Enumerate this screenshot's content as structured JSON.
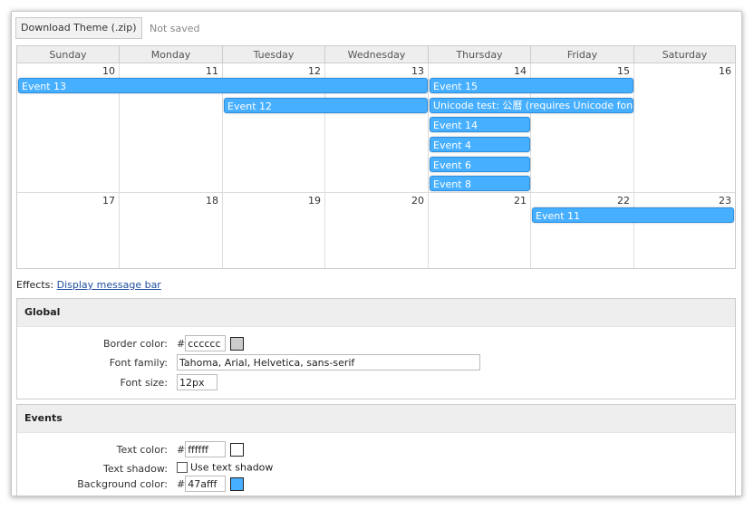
{
  "toolbar": {
    "download_label": "Download Theme (.zip)",
    "status": "Not saved"
  },
  "calendar": {
    "headers": [
      "Sunday",
      "Monday",
      "Tuesday",
      "Wednesday",
      "Thursday",
      "Friday",
      "Saturday"
    ],
    "week1_days": [
      "10",
      "11",
      "12",
      "13",
      "14",
      "15",
      "16"
    ],
    "week2_days": [
      "17",
      "18",
      "19",
      "20",
      "21",
      "22",
      "23"
    ],
    "events": {
      "e13": "Event 13",
      "e15": "Event 15",
      "e12": "Event 12",
      "unicode": "Unicode test: 公曆 (requires Unicode fonts on the client side)",
      "e14": "Event 14",
      "e4": "Event 4",
      "e6": "Event 6",
      "e8": "Event 8",
      "e11": "Event 11"
    }
  },
  "effects": {
    "label": "Effects:",
    "link": "Display message bar"
  },
  "global": {
    "title": "Global",
    "border_color_label": "Border color:",
    "border_color_value": "cccccc",
    "border_color_swatch": "#cccccc",
    "font_family_label": "Font family:",
    "font_family_value": "Tahoma, Arial, Helvetica, sans-serif",
    "font_size_label": "Font size:",
    "font_size_value": "12px"
  },
  "events_panel": {
    "title": "Events",
    "text_color_label": "Text color:",
    "text_color_value": "ffffff",
    "text_color_swatch": "#ffffff",
    "text_shadow_label": "Text shadow:",
    "text_shadow_option": "Use text shadow",
    "text_shadow_checked": false,
    "bg_color_label": "Background color:",
    "bg_color_value": "47afff",
    "bg_color_swatch": "#47afff"
  },
  "hash": "#"
}
